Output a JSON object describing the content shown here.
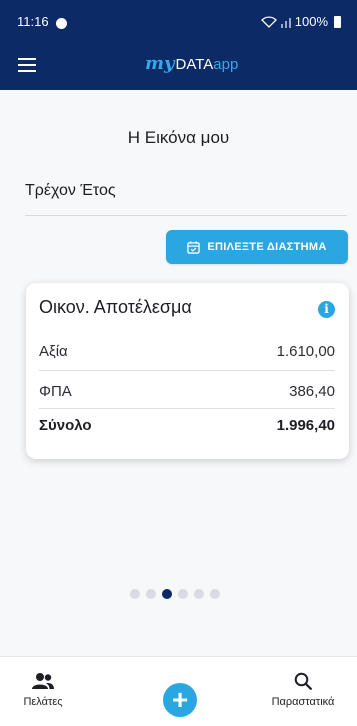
{
  "status_bar": {
    "time": "11:16",
    "battery": "100%"
  },
  "header": {
    "logo_my": "my",
    "logo_data": "DATA",
    "logo_app": "app"
  },
  "page": {
    "title": "Η Εικόνα μου",
    "period_label": "Τρέχον Έτος",
    "select_period_label": "ΕΠΙΛΕΞΤΕ ΔΙΑΣΤΗΜΑ"
  },
  "card": {
    "title": "Οικον. Αποτέλεσμα",
    "rows": [
      {
        "label": "Αξία",
        "value": "1.610,00"
      },
      {
        "label": "ΦΠΑ",
        "value": "386,40"
      },
      {
        "label": "Σύνολο",
        "value": "1.996,40"
      }
    ]
  },
  "pagination": {
    "total": 6,
    "active_index": 2
  },
  "bottom_nav": {
    "customers_label": "Πελάτες",
    "add_label": "+",
    "invoices_label": "Παραστατικά"
  },
  "colors": {
    "header_bg": "#0c2a66",
    "accent": "#2aa6e0"
  }
}
